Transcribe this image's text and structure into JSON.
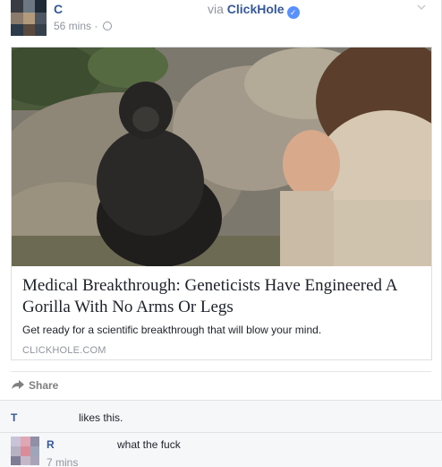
{
  "post": {
    "author": "C",
    "via_prefix": "via",
    "via_page": "ClickHole",
    "timestamp": "56 mins",
    "separator": "·",
    "audience_icon": "globe-icon",
    "verified_icon": "verified-badge-icon"
  },
  "link": {
    "title": "Medical Breakthrough: Geneticists Have Engineered A Gorilla With No Arms Or Legs",
    "description": "Get ready for a scientific breakthrough that will blow your mind.",
    "domain": "CLICKHOLE.COM"
  },
  "actions": {
    "share_label": "Share"
  },
  "likes": {
    "liker": "T",
    "text": "likes this."
  },
  "comment": {
    "author": "R",
    "text": "what the fuck",
    "time": "7 mins"
  },
  "colors": {
    "link_blue": "#365899",
    "muted_gray": "#90949c",
    "verified_blue": "#5890ff",
    "comments_bg": "#f6f7f9"
  }
}
